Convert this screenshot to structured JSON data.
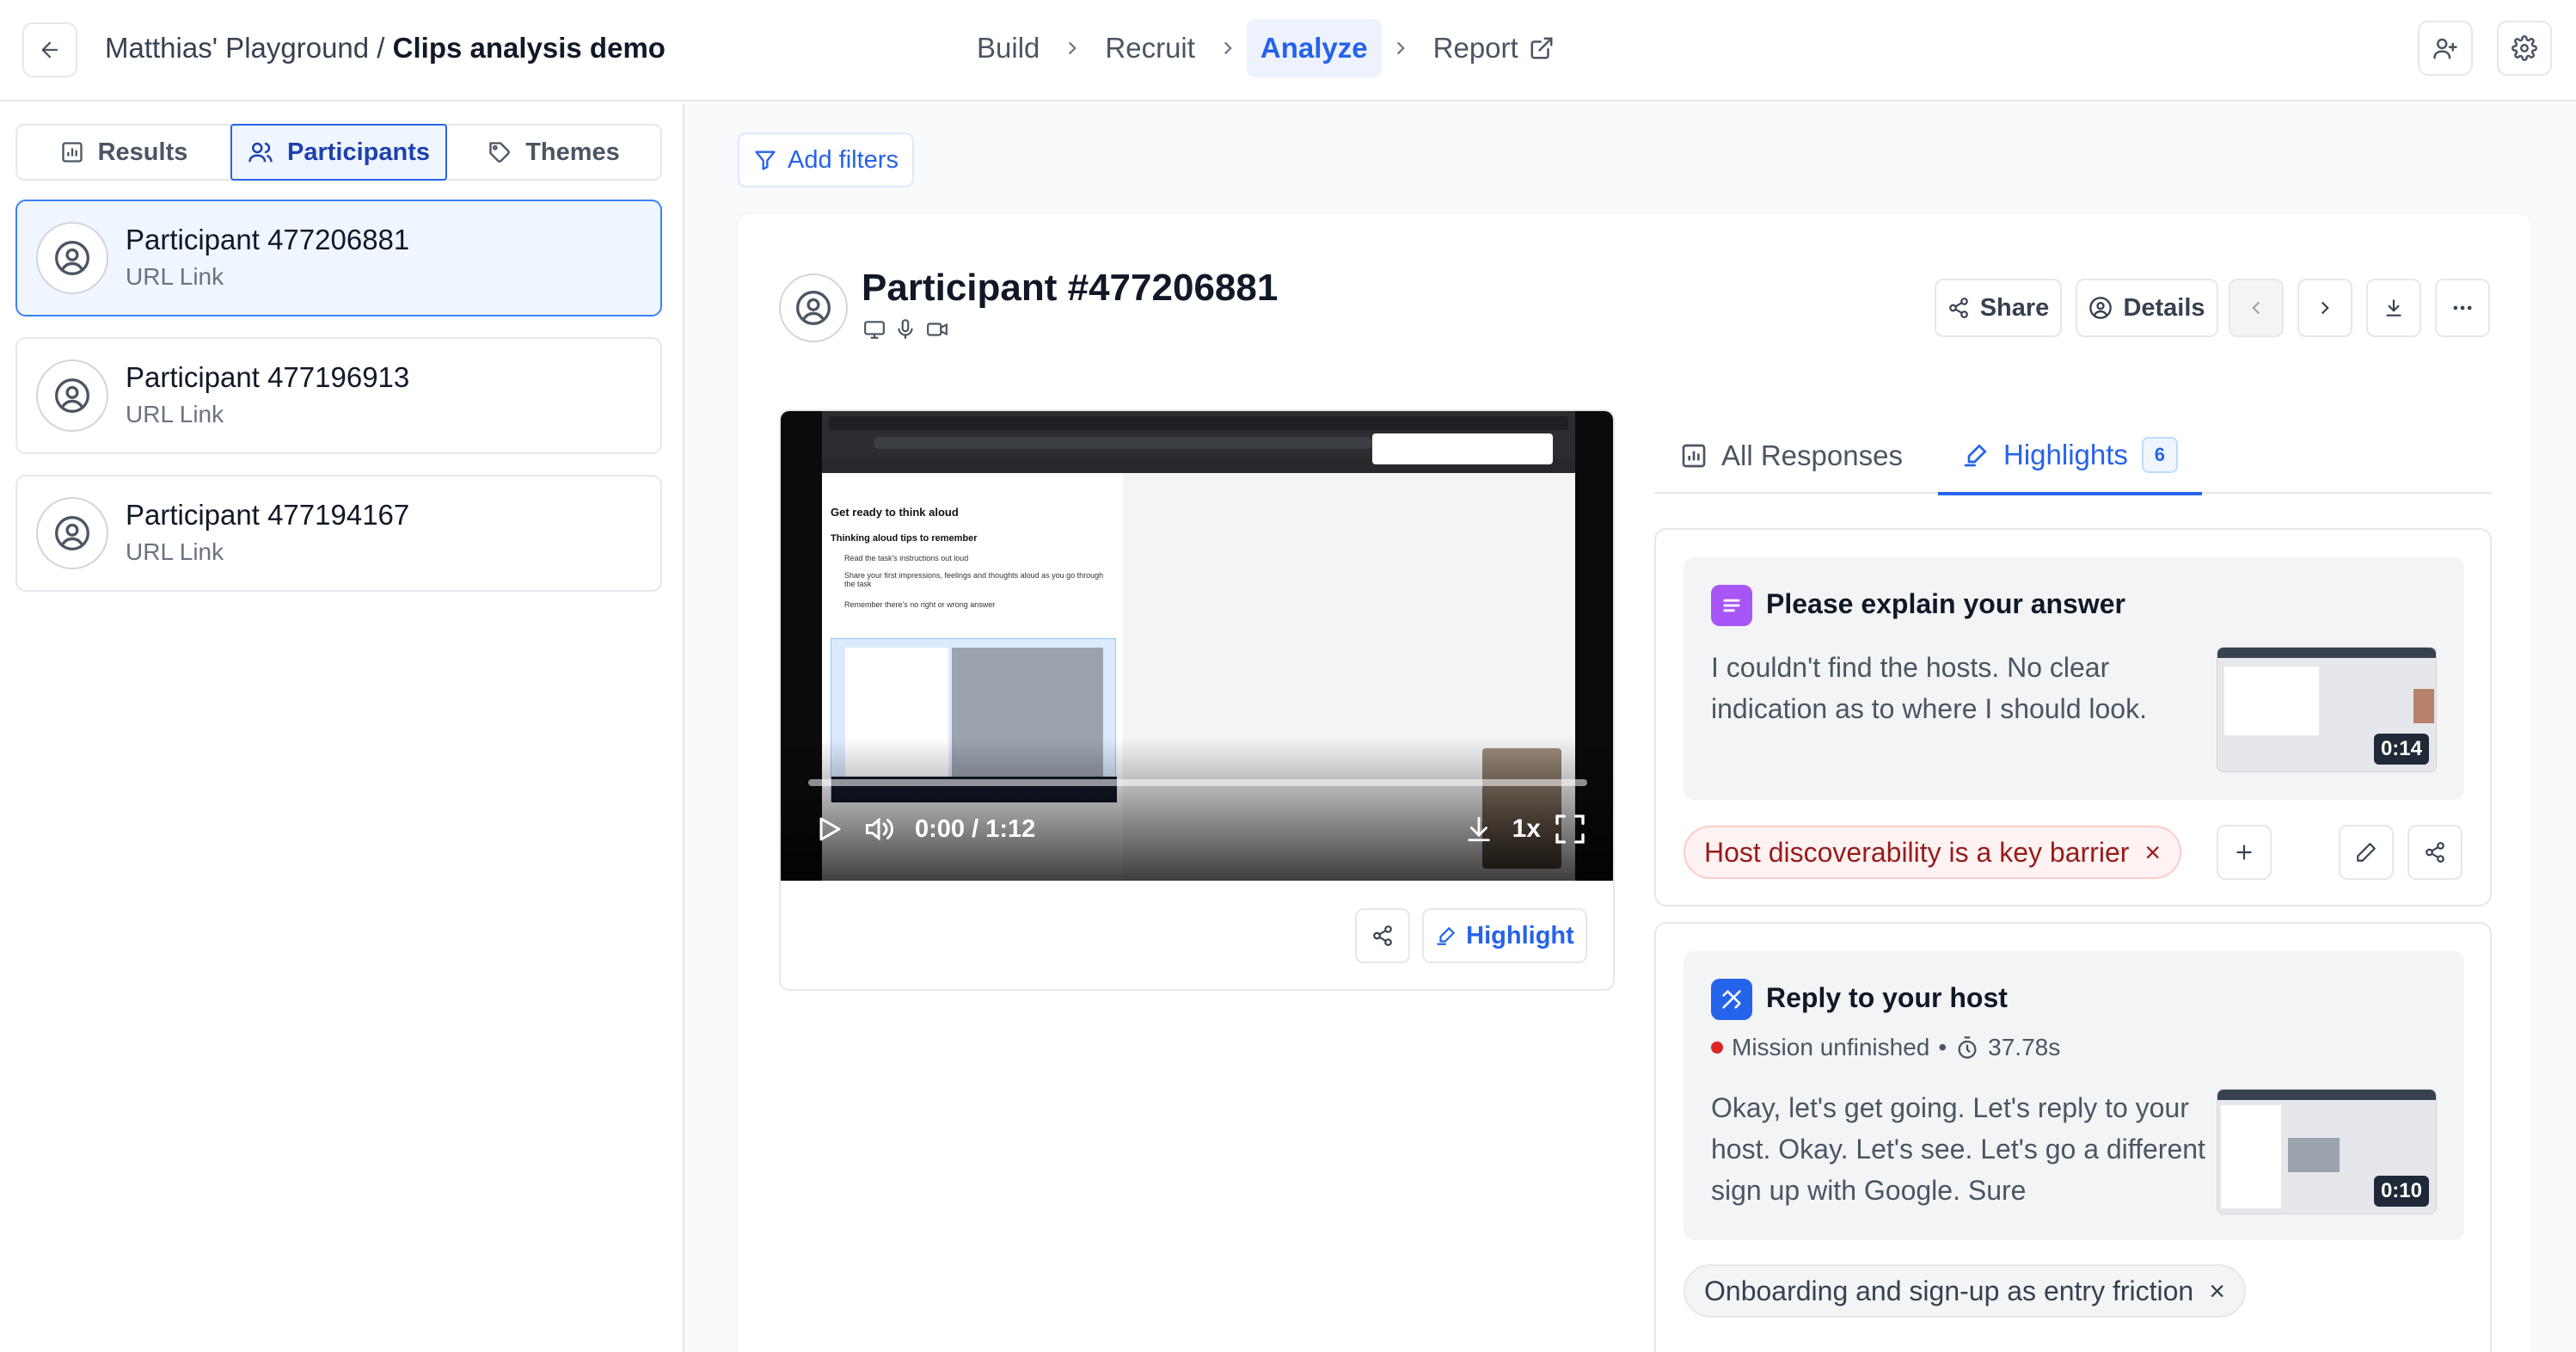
{
  "header": {
    "workspace": "Matthias' Playground",
    "separator": " / ",
    "project": "Clips analysis demo",
    "steps": [
      {
        "label": "Build"
      },
      {
        "label": "Recruit"
      },
      {
        "label": "Analyze",
        "active": true
      },
      {
        "label": "Report"
      }
    ]
  },
  "sidebar": {
    "tabs": [
      {
        "label": "Results",
        "icon": "bar-chart-icon"
      },
      {
        "label": "Participants",
        "icon": "users-icon",
        "active": true
      },
      {
        "label": "Themes",
        "icon": "tag-icon"
      }
    ],
    "participants": [
      {
        "name": "Participant 477206881",
        "source": "URL Link",
        "active": true
      },
      {
        "name": "Participant 477196913",
        "source": "URL Link"
      },
      {
        "name": "Participant 477194167",
        "source": "URL Link"
      }
    ]
  },
  "main": {
    "filters_label": "Add filters",
    "participant_title": "Participant #477206881",
    "toolbar": {
      "share": "Share",
      "details": "Details"
    },
    "video": {
      "time": "0:00 / 1:12",
      "speed": "1x",
      "screen_heading": "Get ready to think aloud",
      "screen_subheading": "Thinking aloud tips to remember",
      "screen_tips": [
        "Read the task's instructions out loud",
        "Share your first impressions, feelings and thoughts aloud as you go through the task",
        "Remember there's no right or wrong answer"
      ],
      "highlight_label": "Highlight"
    },
    "tabs": {
      "all_responses": "All Responses",
      "highlights": "Highlights",
      "highlights_count": "6"
    },
    "highlights": [
      {
        "title": "Please explain your answer",
        "text": "I couldn't find the hosts. No clear indication as to where I should look.",
        "duration": "0:14",
        "tag": "Host discoverability is a key barrier",
        "tag_close": "×"
      },
      {
        "title": "Reply to your host",
        "status": "Mission unfinished",
        "bullet": "•",
        "time": "37.78s",
        "text": "Okay, let's get going. Let's reply to your host. Okay. Let's see. Let's go a different sign up with Google. Sure",
        "duration": "0:10",
        "tag": "Onboarding and sign-up as entry friction",
        "tag_close": "×"
      }
    ]
  },
  "colors": {
    "accent": "#2563eb",
    "purple": "#a855f7",
    "blue_icon": "#2563eb",
    "danger": "#dc2626"
  }
}
